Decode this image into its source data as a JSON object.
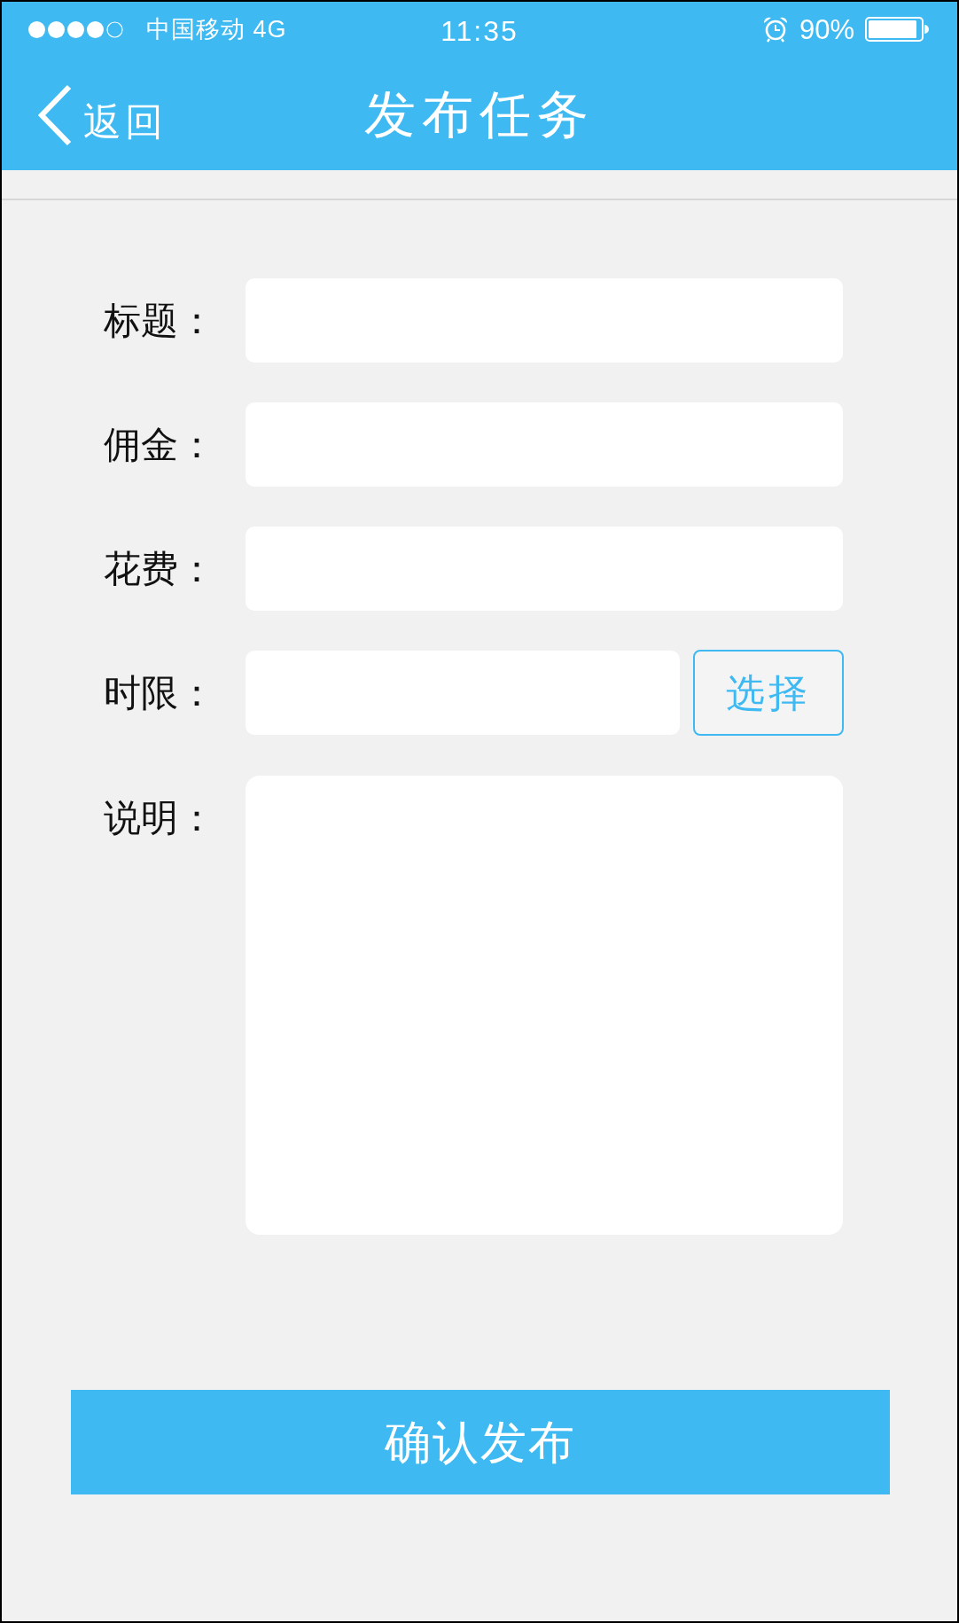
{
  "status_bar": {
    "carrier": "中国移动 4G",
    "time": "11:35",
    "battery": "90%"
  },
  "nav_bar": {
    "back": "返回",
    "title": "发布任务"
  },
  "form": {
    "fields": [
      {
        "kind": "text",
        "label": "标题："
      },
      {
        "kind": "text",
        "label": "佣金："
      },
      {
        "kind": "text",
        "label": "花费："
      },
      {
        "kind": "picker",
        "label": "时限：",
        "button": "选择"
      },
      {
        "kind": "textarea",
        "label": "说明："
      }
    ]
  },
  "submit_button": "确认发布"
}
